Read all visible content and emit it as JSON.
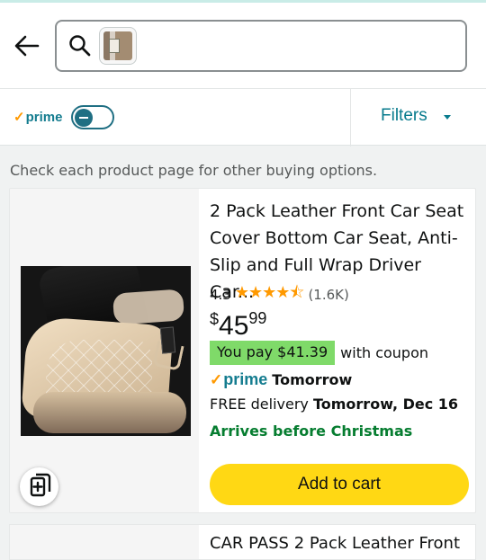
{
  "search": {
    "back_icon": "arrow-left-icon",
    "search_icon": "search-icon",
    "query_image": "product-thumbnail"
  },
  "filters": {
    "prime_label": "prime",
    "prime_check": "✓",
    "prime_toggle": "off",
    "filters_label": "Filters",
    "chevron_icon": "chevron-down-icon"
  },
  "notice": "Check each product page for other buying options.",
  "product": {
    "title": "2 Pack Leather Front Car Seat Cover Bottom Car Seat, Anti-Slip and Full Wrap Driver Car...",
    "rating": "4.3",
    "stars": "★★★★⯪",
    "review_count": "(1.6K)",
    "price_symbol": "$",
    "price_whole": "45",
    "price_fraction": "99",
    "coupon_label": "You pay $41.39",
    "coupon_suffix": "with coupon",
    "prime_label": "prime",
    "prime_check": "✓",
    "prime_delivery": "Tomorrow",
    "delivery_prefix": "FREE delivery ",
    "delivery_date": "Tomorrow, Dec 16",
    "arrival_message": "Arrives before Christmas",
    "add_to_cart": "Add to cart",
    "compare_icon": "add-to-compare-icon"
  },
  "next_product": {
    "title": "CAR PASS 2 Pack Leather Front"
  },
  "colors": {
    "prime": "#147c8f",
    "prime_check": "#ff9900",
    "coupon": "#7fda69",
    "add_to_cart": "#ffd814",
    "success_text": "#067d30"
  }
}
